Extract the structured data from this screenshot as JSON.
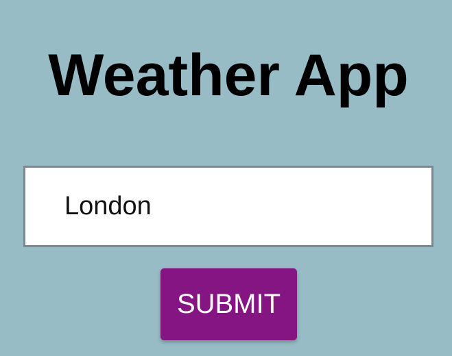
{
  "app": {
    "title": "Weather App"
  },
  "search": {
    "value": "London",
    "placeholder": ""
  },
  "actions": {
    "submit_label": "SUBMIT"
  },
  "colors": {
    "background": "#98bcc6",
    "button": "#861584",
    "button_text": "#ffffff",
    "input_border": "#7d8890"
  }
}
